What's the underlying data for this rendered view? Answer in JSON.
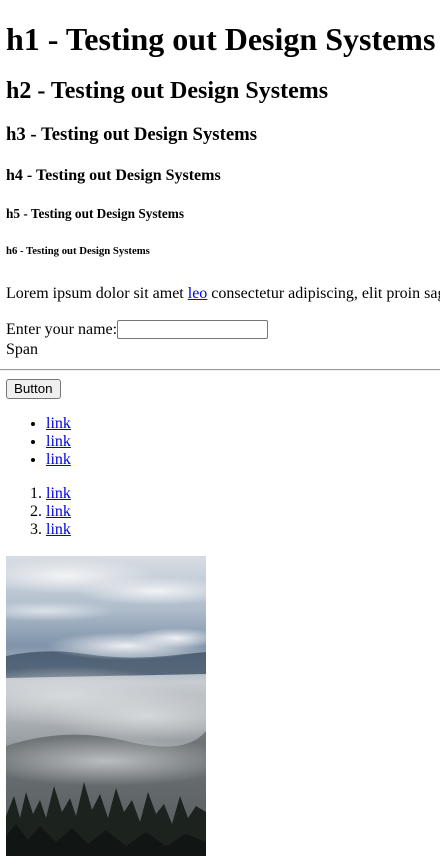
{
  "headings": {
    "h1": "h1 - Testing out Design Systems",
    "h2": "h2 - Testing out Design Systems",
    "h3": "h3 - Testing out Design Systems",
    "h4": "h4 - Testing out Design Systems",
    "h5": "h5 - Testing out Design Systems",
    "h6": "h6 - Testing out Design Systems"
  },
  "paragraph": {
    "before_link": "Lorem ipsum dolor sit amet ",
    "link": "leo",
    "after_link": " consectetur adipiscing, elit proin sagittis"
  },
  "form": {
    "label": "Enter your name:",
    "input_value": ""
  },
  "span_text": "Span",
  "button_label": "Button",
  "unordered_list": [
    "link",
    "link",
    "link"
  ],
  "ordered_list": [
    "link",
    "link",
    "link"
  ],
  "image": {
    "icon": "mountain-clouds-image",
    "colors": {
      "sky": "#c9d2dc",
      "cloud": "#eef0f3",
      "forest": "#1a211d",
      "fog": "#9aa0a5"
    }
  },
  "colors": {
    "link": "#0000ee",
    "text": "#000000",
    "button_bg": "#efefef"
  }
}
